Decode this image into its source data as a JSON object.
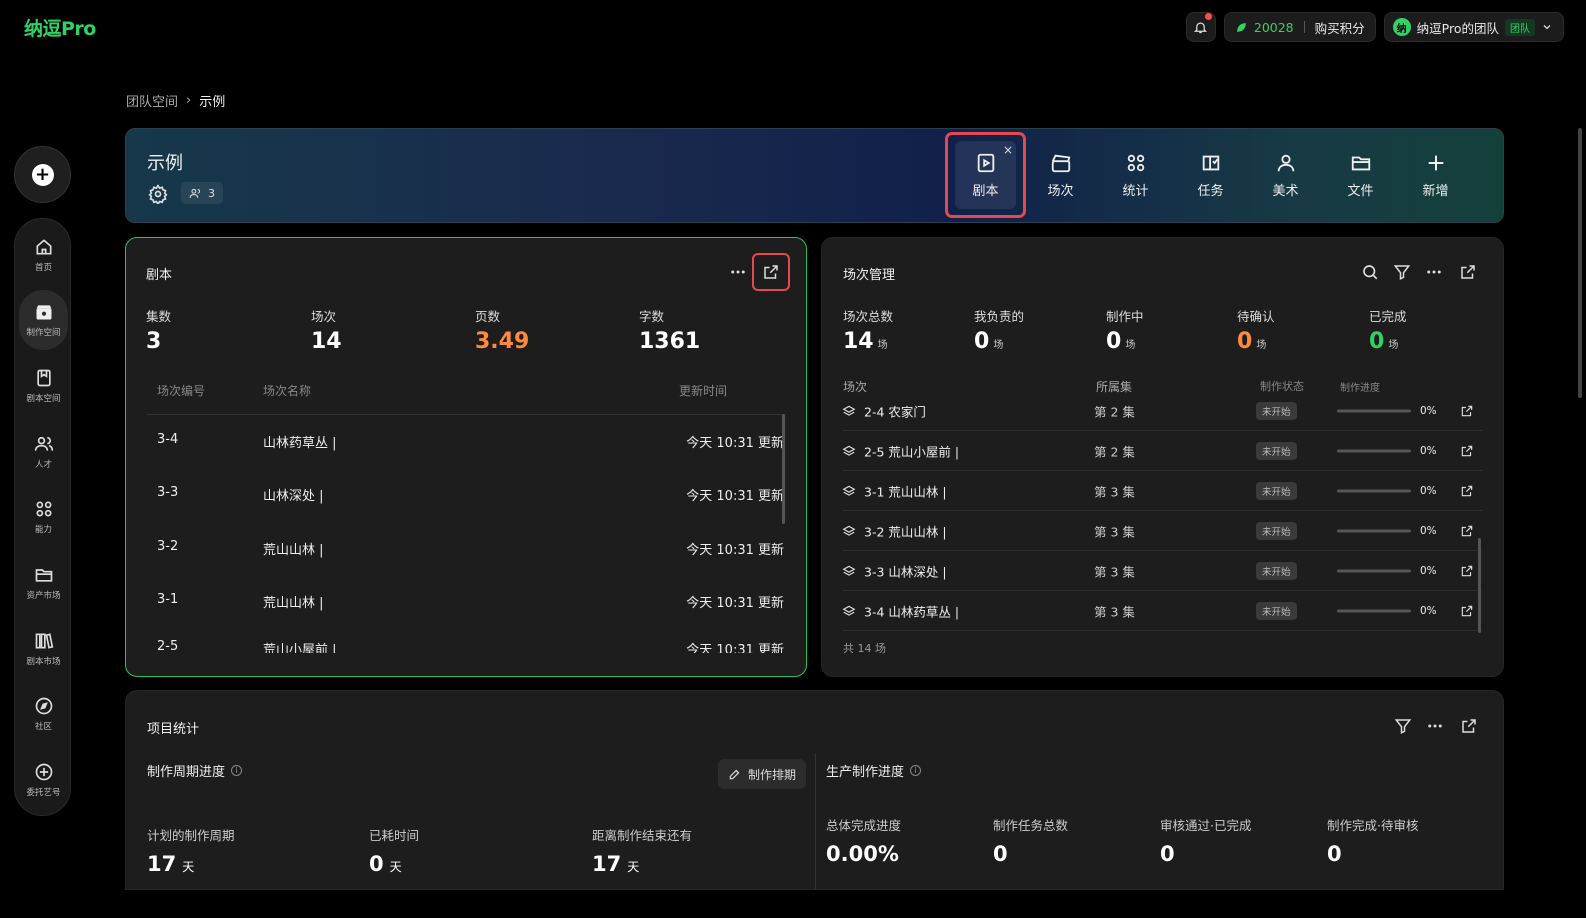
{
  "app": {
    "logo": "纳逗Pro"
  },
  "topbar": {
    "credits_value": "20028",
    "buy_label": "购买积分",
    "team_avatar": "纳",
    "team_name": "纳逗Pro的团队",
    "team_tag": "团队"
  },
  "rail": {
    "items": [
      {
        "label": "首页",
        "icon": "home-icon"
      },
      {
        "label": "制作空间",
        "icon": "clapper-icon"
      },
      {
        "label": "剧本空间",
        "icon": "book-icon"
      },
      {
        "label": "人才",
        "icon": "people-icon"
      },
      {
        "label": "能力",
        "icon": "grid-icon"
      },
      {
        "label": "资产市场",
        "icon": "folder-icon"
      },
      {
        "label": "剧本市场",
        "icon": "library-icon"
      },
      {
        "label": "社区",
        "icon": "compass-icon"
      },
      {
        "label": "委托艺号",
        "icon": "plus-circle-icon"
      }
    ]
  },
  "breadcrumb": {
    "root": "团队空间",
    "current": "示例"
  },
  "project": {
    "title": "示例",
    "members_count": "3",
    "tabs": [
      {
        "label": "剧本",
        "icon": "script-icon",
        "active": true
      },
      {
        "label": "场次",
        "icon": "clapperboard-icon"
      },
      {
        "label": "统计",
        "icon": "stats-icon"
      },
      {
        "label": "任务",
        "icon": "task-icon"
      },
      {
        "label": "美术",
        "icon": "person-icon"
      },
      {
        "label": "文件",
        "icon": "folder-open-icon"
      },
      {
        "label": "新增",
        "icon": "plus-icon"
      }
    ]
  },
  "script_card": {
    "title": "剧本",
    "stats": [
      {
        "label": "集数",
        "value": "3"
      },
      {
        "label": "场次",
        "value": "14"
      },
      {
        "label": "页数",
        "value": "3.49"
      },
      {
        "label": "字数",
        "value": "1361"
      }
    ],
    "columns": [
      "场次编号",
      "场次名称",
      "更新时间"
    ],
    "rows": [
      {
        "no": "3-4",
        "name": "山林药草丛 |",
        "time": "今天 10:31 更新"
      },
      {
        "no": "3-3",
        "name": "山林深处 |",
        "time": "今天 10:31 更新"
      },
      {
        "no": "3-2",
        "name": "荒山山林 |",
        "time": "今天 10:31 更新"
      },
      {
        "no": "3-1",
        "name": "荒山山林 |",
        "time": "今天 10:31 更新"
      },
      {
        "no": "2-5",
        "name": "荒山小屋前 |",
        "time": "今天 10:31 更新"
      }
    ]
  },
  "scene_card": {
    "title": "场次管理",
    "stats": [
      {
        "label": "场次总数",
        "value": "14",
        "unit": "场"
      },
      {
        "label": "我负责的",
        "value": "0",
        "unit": "场"
      },
      {
        "label": "制作中",
        "value": "0",
        "unit": "场"
      },
      {
        "label": "待确认",
        "value": "0",
        "unit": "场"
      },
      {
        "label": "已完成",
        "value": "0",
        "unit": "场"
      }
    ],
    "columns": [
      "场次",
      "所属集",
      "制作状态",
      "制作进度"
    ],
    "rows": [
      {
        "scene": "2-4 农家门",
        "episode": "第 2 集",
        "status": "未开始",
        "progress": 0,
        "progress_label": "0%"
      },
      {
        "scene": "2-5 荒山小屋前 |",
        "episode": "第 2 集",
        "status": "未开始",
        "progress": 0,
        "progress_label": "0%"
      },
      {
        "scene": "3-1 荒山山林 |",
        "episode": "第 3 集",
        "status": "未开始",
        "progress": 0,
        "progress_label": "0%"
      },
      {
        "scene": "3-2 荒山山林 |",
        "episode": "第 3 集",
        "status": "未开始",
        "progress": 0,
        "progress_label": "0%"
      },
      {
        "scene": "3-3 山林深处 |",
        "episode": "第 3 集",
        "status": "未开始",
        "progress": 0,
        "progress_label": "0%"
      },
      {
        "scene": "3-4 山林药草丛 |",
        "episode": "第 3 集",
        "status": "未开始",
        "progress": 0,
        "progress_label": "0%"
      }
    ],
    "footer": "共 14 场"
  },
  "stats_card": {
    "title": "项目统计",
    "cycle_title": "制作周期进度",
    "schedule_button": "制作排期",
    "cycle": [
      {
        "label": "计划的制作周期",
        "value": "17",
        "unit": "天"
      },
      {
        "label": "已耗时间",
        "value": "0",
        "unit": "天"
      },
      {
        "label": "距离制作结束还有",
        "value": "17",
        "unit": "天"
      }
    ],
    "production_title": "生产制作进度",
    "production": [
      {
        "label": "总体完成进度",
        "value": "0.00%"
      },
      {
        "label": "制作任务总数",
        "value": "0"
      },
      {
        "label": "审核通过·已完成",
        "value": "0"
      },
      {
        "label": "制作完成·待审核",
        "value": "0"
      }
    ]
  },
  "colors": {
    "accent": "#2fd365",
    "highlight": "#e5484d",
    "page_value_orange": "#ff8a3d",
    "pending_orange": "#ff8a3d",
    "done_green": "#2fd365"
  }
}
